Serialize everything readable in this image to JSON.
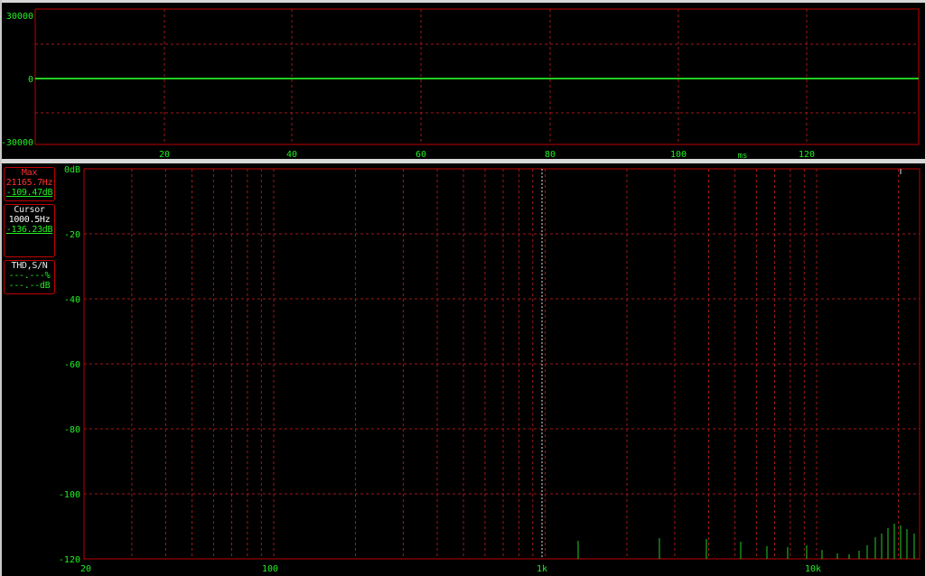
{
  "waveform": {
    "y_ticks": [
      "30000",
      "0",
      "-30000"
    ],
    "x_ticks": [
      "20",
      "40",
      "60",
      "80",
      "100",
      "120"
    ],
    "x_unit": "ms"
  },
  "spectrum": {
    "y_ticks": [
      "0dB",
      "-20",
      "-40",
      "-60",
      "-80",
      "-100",
      "-120"
    ],
    "x_ticks": [
      "20",
      "100",
      "1k",
      "10k"
    ]
  },
  "max_box": {
    "title": "Max",
    "freq": "21165.7Hz",
    "level": "-109.47dB"
  },
  "cursor_box": {
    "title": "Cursor",
    "freq": "1000.5Hz",
    "level": "-136.23dB"
  },
  "thd_box": {
    "title": "THD,S/N",
    "percent": "---.---%",
    "db": "---.--dB"
  },
  "colors": {
    "grid": "#a01818",
    "frame": "#c00000",
    "trace": "#22cc22",
    "label": "#22ee22",
    "cursor": "#e0e0e0"
  }
}
